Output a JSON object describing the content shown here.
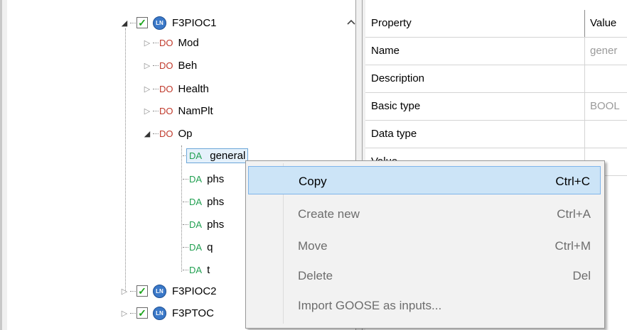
{
  "tree": {
    "root": {
      "label": "F3PIOC1",
      "icon": "LN"
    },
    "do_nodes": [
      {
        "tag": "DO",
        "label": "Mod"
      },
      {
        "tag": "DO",
        "label": "Beh"
      },
      {
        "tag": "DO",
        "label": "Health"
      },
      {
        "tag": "DO",
        "label": "NamPlt"
      },
      {
        "tag": "DO",
        "label": "Op"
      }
    ],
    "da_nodes": [
      {
        "tag": "DA",
        "label": "general"
      },
      {
        "tag": "DA",
        "label": "phs"
      },
      {
        "tag": "DA",
        "label": "phs"
      },
      {
        "tag": "DA",
        "label": "phs"
      },
      {
        "tag": "DA",
        "label": "q"
      },
      {
        "tag": "DA",
        "label": "t"
      }
    ],
    "siblings": [
      {
        "icon": "LN",
        "label": "F3PIOC2"
      },
      {
        "icon": "LN",
        "label": "F3PTOC"
      }
    ]
  },
  "properties": {
    "header": {
      "property": "Property",
      "value": "Value"
    },
    "rows": [
      {
        "name": "Name",
        "value": "gener"
      },
      {
        "name": "Description",
        "value": ""
      },
      {
        "name": "Basic type",
        "value": "BOOL"
      },
      {
        "name": "Data type",
        "value": ""
      },
      {
        "name": "Value",
        "value": ""
      }
    ]
  },
  "context_menu": {
    "items": [
      {
        "label": "Copy",
        "shortcut": "Ctrl+C"
      },
      {
        "label": "Create new",
        "shortcut": "Ctrl+A"
      },
      {
        "label": "Move",
        "shortcut": "Ctrl+M"
      },
      {
        "label": "Delete",
        "shortcut": "Del"
      },
      {
        "label": "Import GOOSE as inputs...",
        "shortcut": ""
      }
    ]
  },
  "icons": {
    "expanded": "expanded-triangle-icon",
    "collapsed": "collapsed-triangle-icon",
    "checkbox": "checked-checkbox-icon",
    "logical_node": "logical-node-icon",
    "scroll_up": "chevron-up-icon"
  },
  "colors": {
    "do_tag": "#c0392b",
    "da_tag": "#22a052",
    "ln_icon": "#3a78c8",
    "selection": "#e5f1fb",
    "menu_hover": "#cce4f7"
  }
}
